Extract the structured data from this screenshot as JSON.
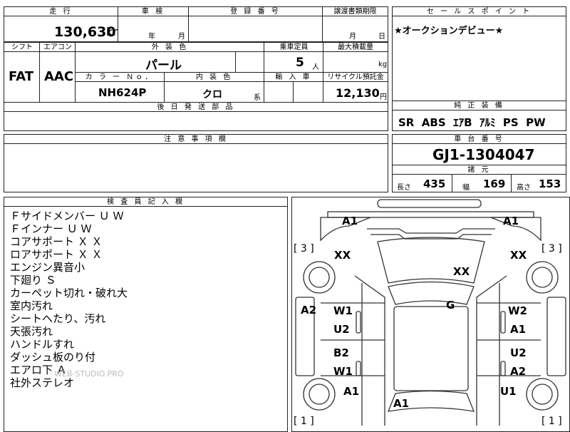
{
  "top": {
    "mileage_label": "走 行",
    "mileage_value": "130,630",
    "mileage_unit": "km",
    "inspection_label": "車 検",
    "inspection_year_unit": "年",
    "inspection_month_unit": "月",
    "registration_label": "登 録 番 号",
    "transfer_label": "譲渡書類期限",
    "transfer_month_unit": "月",
    "transfer_day_unit": "日",
    "sales_point_label": "セ ー ル ス ポ イ ン ト",
    "sales_point_text": "★オークションデビュー★"
  },
  "specs": {
    "shift_label": "シフト",
    "shift_value": "FAT",
    "ac_label": "エアコン",
    "ac_value": "AAC",
    "exterior_color_label": "外 装 色",
    "exterior_color_value": "パール",
    "capacity_label": "乗車定員",
    "capacity_value": "5",
    "capacity_unit": "人",
    "max_load_label": "最大積載量",
    "max_load_unit": "kg",
    "color_no_label": "カ ラ ー Ｎｏ．",
    "color_no_value": "NH624P",
    "interior_color_label": "内 装 色",
    "interior_color_value": "クロ",
    "interior_color_unit": "系",
    "import_label": "輸 入 車",
    "recycle_label": "リサイクル預託金",
    "recycle_value": "12,130",
    "recycle_unit": "円",
    "parts_label": "後 日 発 送 部 品"
  },
  "equipment": {
    "label": "純 正 装 備",
    "value": "SR  ABS  ｴｱB  ｱﾙﾐ  PS  PW"
  },
  "notes_label": "注 意 事 項 欄",
  "chassis": {
    "label": "車 台 番 号",
    "value": "GJ1-1304047",
    "dims_label": "諸 元",
    "length_label": "長さ",
    "length_value": "435",
    "width_label": "幅",
    "width_value": "169",
    "height_label": "高さ",
    "height_value": "153"
  },
  "inspector": {
    "label": "検 査 員 記 入 欄",
    "notes": [
      "Ｆサイドメンバー Ｕ Ｗ",
      "Ｆインナー Ｕ Ｗ",
      "コアサポート Ｘ Ｘ",
      "ロアサポート Ｘ Ｘ",
      "エンジン異音小",
      "下廻り Ｓ",
      "カーペット切れ・破れ大",
      "室内汚れ",
      "シートへたり、汚れ",
      "天張汚れ",
      "ハンドルすれ",
      "ダッシュ板のり付",
      "エアロ下 Ａ",
      "社外ステレオ"
    ]
  },
  "watermark": "WEB-STUDIO.PRO",
  "diagram": {
    "tire_fl": "[ 3 ]",
    "tire_fr": "[ 3 ]",
    "tire_rl": "[ 1 ]",
    "tire_rr": "[ 1 ]",
    "marks": {
      "front_left": "A1",
      "front_right": "A1",
      "fender_left": "XX",
      "fender_right": "XX",
      "hood": "XX",
      "pillar_left": "A2",
      "roof": "G",
      "front_door_left_top": "W1",
      "front_door_left_bottom": "U2",
      "front_door_right_top": "W2",
      "front_door_right_bottom": "A1",
      "rear_door_left_top": "B2",
      "rear_door_left_bottom": "W1",
      "rear_door_right_top": "U2",
      "rear_door_right_bottom": "A2",
      "quarter_left": "A1",
      "quarter_right": "U1",
      "rear_center": "A1"
    }
  }
}
